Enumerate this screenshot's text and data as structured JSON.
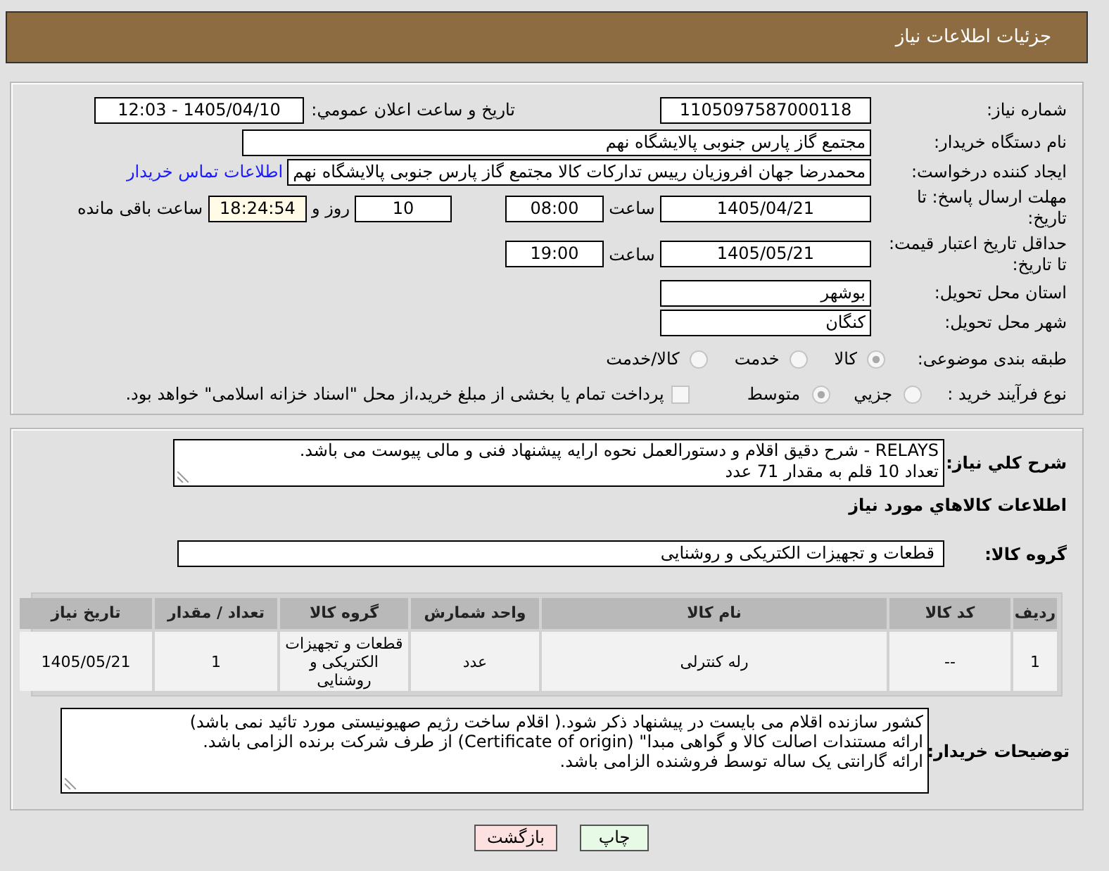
{
  "header": {
    "title": "جزئیات اطلاعات نیاز"
  },
  "details": {
    "need_number": {
      "label": "شماره نیاز:",
      "value": "1105097587000118"
    },
    "announce": {
      "label": "تاریخ و ساعت اعلان عمومي:",
      "value": "1405/04/10 - 12:03"
    },
    "buyer": {
      "label": "نام دستگاه خریدار:",
      "value": "مجتمع گاز پارس جنوبی  پالایشگاه نهم"
    },
    "requester": {
      "label": "ایجاد کننده درخواست:",
      "value": "محمدرضا جهان افروزیان رییس تدارکات کالا مجتمع گاز پارس جنوبی  پالایشگاه نهم",
      "contact_link": "اطلاعات تماس خریدار"
    },
    "deadline": {
      "label": "مهلت ارسال پاسخ: تا تاریخ:",
      "date": "1405/04/21",
      "time_label": "ساعت",
      "time": "08:00",
      "days": "10",
      "days_label": "روز و",
      "remaining": "18:24:54",
      "remaining_label": "ساعت باقی مانده"
    },
    "validity": {
      "label": "حداقل تاریخ اعتبار قیمت: تا تاریخ:",
      "date": "1405/05/21",
      "time_label": "ساعت",
      "time": "19:00"
    },
    "province": {
      "label": "استان محل تحویل:",
      "value": "بوشهر"
    },
    "city": {
      "label": "شهر محل تحویل:",
      "value": "کنگان"
    },
    "category": {
      "label": "طبقه بندی موضوعی:",
      "options": [
        {
          "label": "کالا",
          "selected": true
        },
        {
          "label": "خدمت",
          "selected": false
        },
        {
          "label": "کالا/خدمت",
          "selected": false
        }
      ]
    },
    "purchase_type": {
      "label": "نوع فرآیند خرید :",
      "options": [
        {
          "label": "جزيي",
          "selected": false
        },
        {
          "label": "متوسط",
          "selected": true
        }
      ],
      "treasury": {
        "label": "پرداخت تمام یا بخشی از مبلغ خرید،از محل \"اسناد خزانه اسلامی\" خواهد بود.",
        "checked": false
      }
    }
  },
  "need": {
    "description": {
      "label": "شرح کلي نياز:",
      "value": "RELAYS - شرح دقیق اقلام و دستورالعمل نحوه ارایه پیشنهاد فنی و مالی پیوست می باشد.\nتعداد 10 قلم به مقدار 71 عدد"
    },
    "goods_title": "اطلاعات کالاهاي مورد نياز",
    "group": {
      "label": "گروه کالا:",
      "value": "قطعات و تجهیزات الکتریکی و روشنایی"
    },
    "table": {
      "columns": [
        "ردیف",
        "کد کالا",
        "نام کالا",
        "واحد شمارش",
        "گروه کالا",
        "تعداد / مقدار",
        "تاریخ نیاز"
      ],
      "rows": [
        [
          "1",
          "--",
          "رله کنترلی",
          "عدد",
          "قطعات و تجهیزات الکتریکی و روشنایی",
          "1",
          "1405/05/21"
        ]
      ]
    },
    "notes": {
      "label": "توضیحات خریدار:",
      "value": "کشور سازنده اقلام می بایست در پیشنهاد ذکر شود.( اقلام ساخت رژیم صهیونیستی مورد تائید نمی باشد)\nارائه مستندات اصالت کالا و گواهی مبدا\" (Certificate of origin) از طرف شرکت برنده الزامی باشد.\nارائه گارانتی یک ساله توسط فروشنده الزامی باشد."
    }
  },
  "buttons": [
    {
      "kind": "print",
      "label": "چاپ"
    },
    {
      "kind": "back",
      "label": "بازگشت"
    }
  ]
}
